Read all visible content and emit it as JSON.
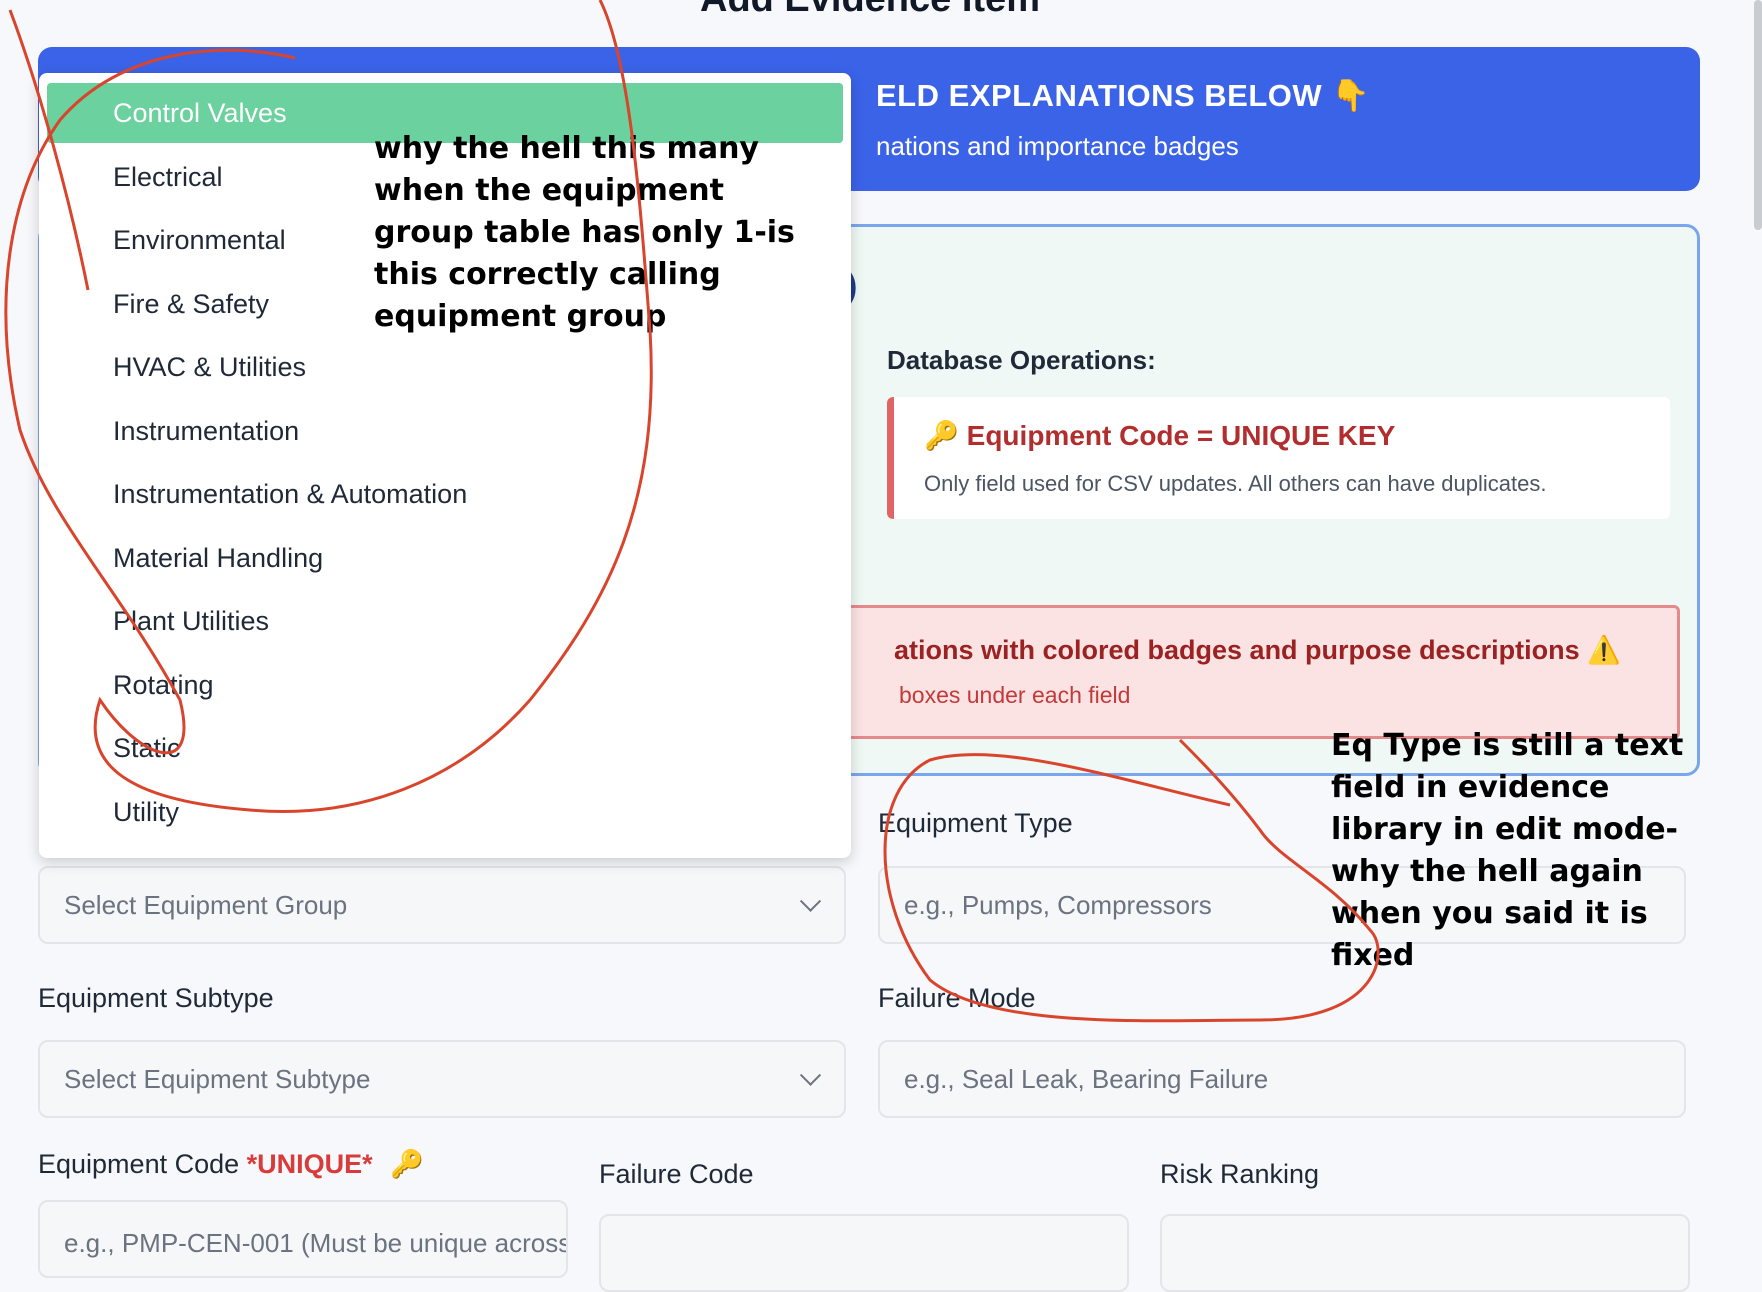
{
  "page_title": "Add Evidence Item",
  "banner": {
    "title": "ELD EXPLANATIONS BELOW",
    "title_icon": "👇",
    "subtitle": "nations and importance badges"
  },
  "info_panel": {
    "partial_heading": ")",
    "db_ops_label": "Database Operations:",
    "key_icon": "🔑",
    "key_title": "Equipment Code = UNIQUE KEY",
    "key_desc": "Only field used for CSV updates. All others can have duplicates.",
    "alert_title": "ations with colored badges and purpose descriptions",
    "alert_icon": "⚠️",
    "alert_sub": "boxes under each field"
  },
  "form": {
    "equipment_group": {
      "placeholder": "Select Equipment Group"
    },
    "equipment_type": {
      "label": "Equipment Type",
      "placeholder": "e.g., Pumps, Compressors"
    },
    "equipment_subtype": {
      "label": "Equipment Subtype",
      "placeholder": "Select Equipment Subtype"
    },
    "failure_mode": {
      "label": "Failure Mode",
      "placeholder": "e.g., Seal Leak, Bearing Failure"
    },
    "equipment_code": {
      "label": "Equipment Code",
      "unique_tag": "*UNIQUE*",
      "key_icon": "🔑",
      "placeholder": "e.g., PMP-CEN-001 (Must be unique across"
    },
    "failure_code": {
      "label": "Failure Code"
    },
    "risk_ranking": {
      "label": "Risk Ranking"
    }
  },
  "dropdown": {
    "items": [
      "Control Valves",
      "Electrical",
      "Environmental",
      "Fire & Safety",
      "HVAC & Utilities",
      "Instrumentation",
      "Instrumentation & Automation",
      "Material Handling",
      "Plant Utilities",
      "Rotating",
      "Static",
      "Utility"
    ],
    "selected": "Control Valves"
  },
  "annotations": {
    "note_1": [
      "why the hell this many",
      "when the equipment",
      "group table has only 1-is",
      "this correctly calling",
      "equipment group"
    ],
    "note_2": [
      "Eq Type is still a text",
      "field in evidence",
      "library in edit mode-",
      "why the hell again",
      "when you said it is",
      "fixed"
    ]
  },
  "colors": {
    "banner_blue": "#3b63e8",
    "selected_green": "#6bd19e",
    "alert_red": "#9b2222",
    "ink_red": "#d9452c"
  }
}
